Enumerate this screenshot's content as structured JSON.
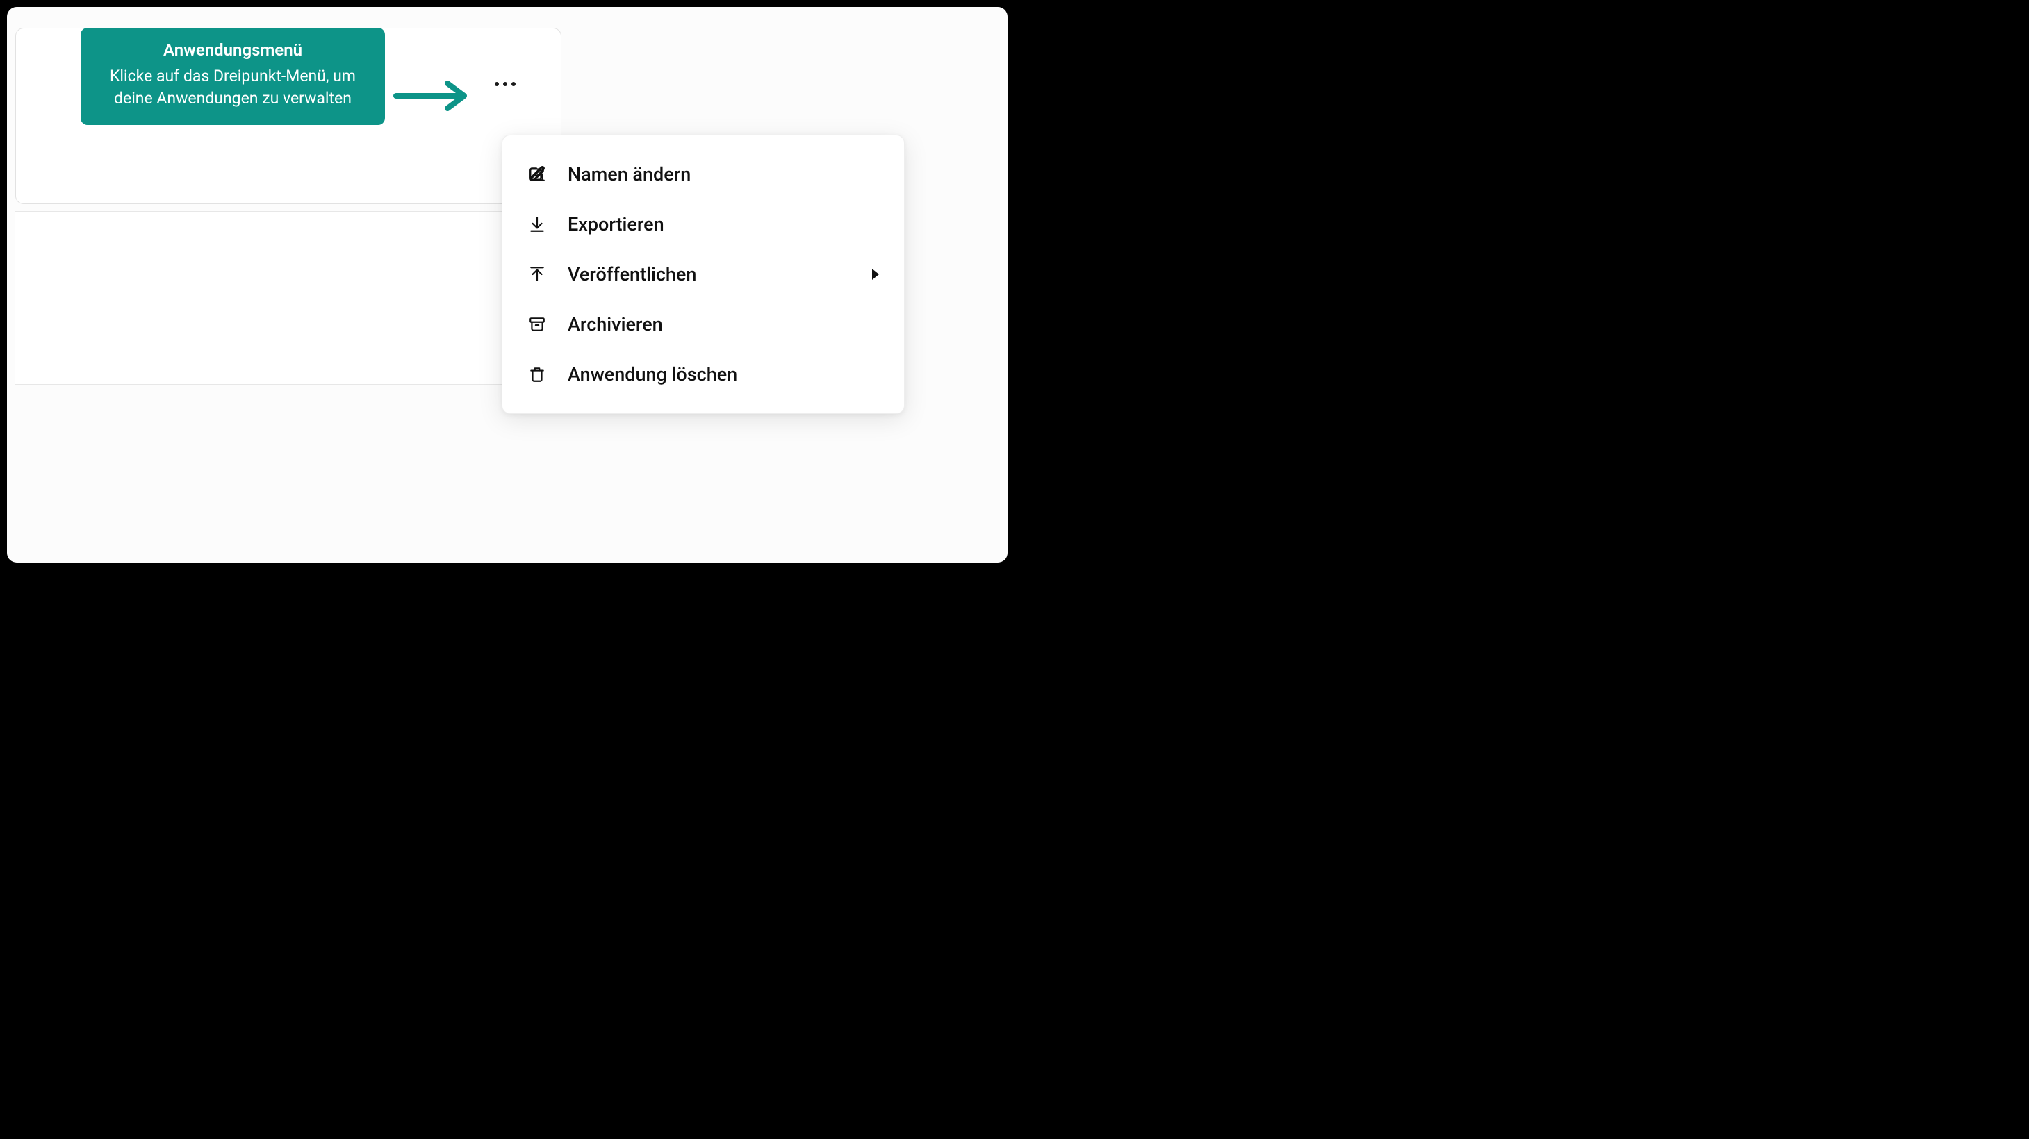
{
  "tooltip": {
    "title": "Anwendungsmenü",
    "body": "Klicke auf das Dreipunkt-Menü, um deine Anwendungen zu verwalten"
  },
  "colors": {
    "accent": "#0d9488"
  },
  "menu": {
    "items": [
      {
        "icon": "edit-icon",
        "label": "Namen ändern",
        "has_submenu": false
      },
      {
        "icon": "download-icon",
        "label": "Exportieren",
        "has_submenu": false
      },
      {
        "icon": "upload-icon",
        "label": "Veröffentlichen",
        "has_submenu": true
      },
      {
        "icon": "archive-icon",
        "label": "Archivieren",
        "has_submenu": false
      },
      {
        "icon": "trash-icon",
        "label": "Anwendung löschen",
        "has_submenu": false
      }
    ]
  }
}
